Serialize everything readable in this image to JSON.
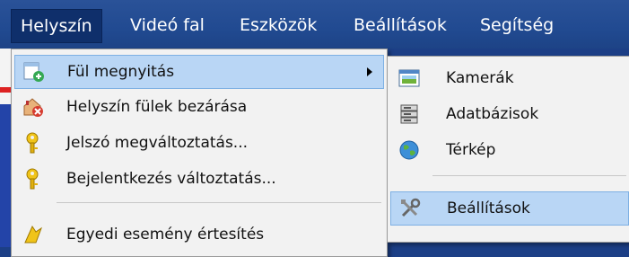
{
  "menubar": {
    "items": [
      {
        "label": "Helyszín"
      },
      {
        "label": "Videó fal"
      },
      {
        "label": "Eszközök"
      },
      {
        "label": "Beállítások"
      },
      {
        "label": "Segítség"
      }
    ]
  },
  "menu": {
    "items": [
      {
        "label": "Fül megnyitás",
        "icon": "tab-add-icon"
      },
      {
        "label": "Helyszín fülek bezárása",
        "icon": "close-tabs-icon"
      },
      {
        "label": "Jelszó megváltoztatás...",
        "icon": "key-icon"
      },
      {
        "label": "Bejelentkezés változtatás...",
        "icon": "key-icon"
      },
      {
        "label": "Egyedi esemény értesítés",
        "icon": "event-icon"
      }
    ]
  },
  "submenu": {
    "items": [
      {
        "label": "Kamerák",
        "icon": "camera-view-icon"
      },
      {
        "label": "Adatbázisok",
        "icon": "database-icon"
      },
      {
        "label": "Térkép",
        "icon": "globe-icon"
      },
      {
        "label": "Beállítások",
        "icon": "tools-icon"
      }
    ]
  }
}
